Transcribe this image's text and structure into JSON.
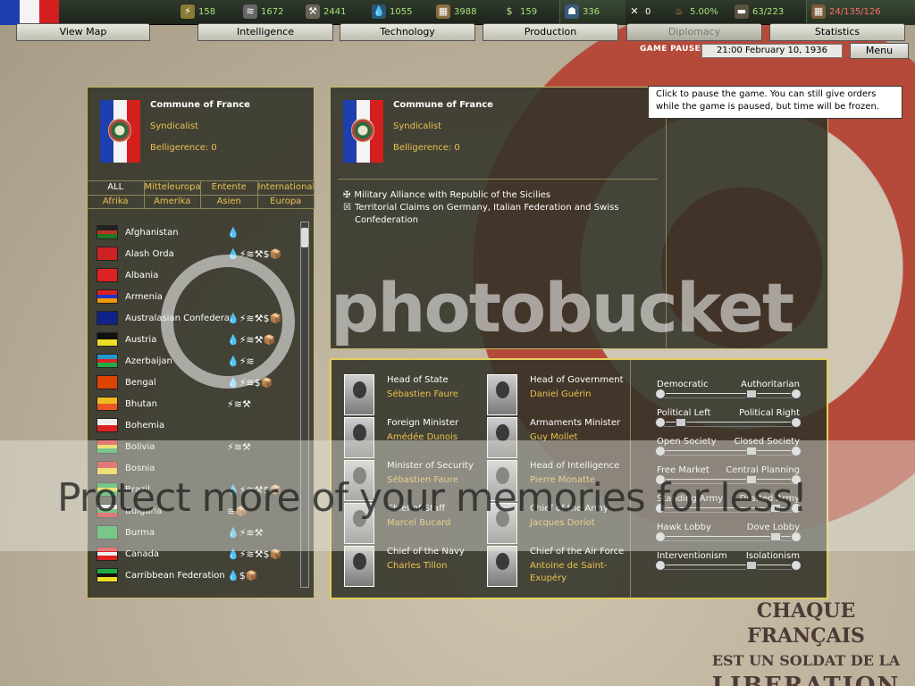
{
  "colors": {
    "accent_gold": "#e9c24f",
    "france_blue": "#1f3fae",
    "france_white": "#f4f4f4",
    "france_red": "#d41f1f"
  },
  "resources": [
    {
      "icon": "energy-icon",
      "value": "158"
    },
    {
      "icon": "metal-icon",
      "value": "1672"
    },
    {
      "icon": "rare-materials-icon",
      "value": "2441"
    },
    {
      "icon": "oil-icon",
      "value": "1055"
    },
    {
      "icon": "supplies-icon",
      "value": "3988"
    },
    {
      "icon": "money-icon",
      "value": "159"
    }
  ],
  "stats": {
    "manpower": "336",
    "diplo_points": "0",
    "dissent": "5.00%",
    "transports": "63/223",
    "convoys": "24/135/126"
  },
  "tabs": [
    "View Map",
    "Intelligence",
    "Technology",
    "Production",
    "Diplomacy",
    "Statistics"
  ],
  "status": {
    "paused": "GAME PAUSED",
    "date": "21:00 February 10, 1936",
    "menu": "Menu",
    "tooltip": "Click to pause the game. You can still give orders while the game is paused, but time will be frozen."
  },
  "country": {
    "name": "Commune of France",
    "ideology": "Syndicalist",
    "belligerence": "Belligerence: 0"
  },
  "filters": {
    "row1": [
      "ALL",
      "Mitteleuropa",
      "Entente",
      "Internationale"
    ],
    "row2": [
      "Afrika",
      "Amerika",
      "Asien",
      "Europa"
    ]
  },
  "countries": [
    {
      "name": "Afghanistan",
      "icons": "💧"
    },
    {
      "name": "Alash Orda",
      "icons": "💧⚡≋⚒$📦"
    },
    {
      "name": "Albania",
      "icons": ""
    },
    {
      "name": "Armenia",
      "icons": ""
    },
    {
      "name": "Australasian Confederation",
      "icons": "💧⚡≋⚒$📦"
    },
    {
      "name": "Austria",
      "icons": "💧⚡≋⚒📦"
    },
    {
      "name": "Azerbaijan",
      "icons": "💧⚡≋"
    },
    {
      "name": "Bengal",
      "icons": "💧⚡≋$📦"
    },
    {
      "name": "Bhutan",
      "icons": "⚡≋⚒"
    },
    {
      "name": "Bohemia",
      "icons": ""
    },
    {
      "name": "Bolivia",
      "icons": "⚡≋⚒"
    },
    {
      "name": "Bosnia",
      "icons": ""
    },
    {
      "name": "Brazil",
      "icons": "💧⚡≋⚒$📦"
    },
    {
      "name": "Bulgaria",
      "icons": "≋📦"
    },
    {
      "name": "Burma",
      "icons": "💧⚡≋⚒"
    },
    {
      "name": "Canada",
      "icons": "💧⚡≋⚒$📦"
    },
    {
      "name": "Carribbean Federation",
      "icons": "💧$📦"
    }
  ],
  "relations": [
    "Military Alliance with Republic of the Sicilies",
    "Territorial Claims on Germany, Italian Federation and Swiss Confederation"
  ],
  "ministers": [
    {
      "title": "Head of State",
      "name": "Sébastien Faure"
    },
    {
      "title": "Head of Government",
      "name": "Daniel Guérin"
    },
    {
      "title": "Foreign Minister",
      "name": "Amédée Dunois"
    },
    {
      "title": "Armaments Minister",
      "name": "Guy Mollet"
    },
    {
      "title": "Minister of Security",
      "name": "Sébastien Faure"
    },
    {
      "title": "Head of Intelligence",
      "name": "Pierre Monatte"
    },
    {
      "title": "Chief of Staff",
      "name": "Marcel Bucard"
    },
    {
      "title": "Chief of the Army",
      "name": "Jacques Doriot"
    },
    {
      "title": "Chief of the Navy",
      "name": "Charles Tillon"
    },
    {
      "title": "Chief of the Air Force",
      "name": "Antoine de Saint-Exupéry"
    }
  ],
  "sliders": [
    {
      "left": "Democratic",
      "right": "Authoritarian",
      "value": 0.7
    },
    {
      "left": "Political Left",
      "right": "Political Right",
      "value": 0.1
    },
    {
      "left": "Open Society",
      "right": "Closed Society",
      "value": 0.7
    },
    {
      "left": "Free Market",
      "right": "Central Planning",
      "value": 0.7
    },
    {
      "left": "Standing Army",
      "right": "Drafted Army",
      "value": 0.9
    },
    {
      "left": "Hawk Lobby",
      "right": "Dove Lobby",
      "value": 0.9
    },
    {
      "left": "Interventionism",
      "right": "Isolationism",
      "value": 0.7
    }
  ],
  "watermark": {
    "brand": "photobucket",
    "slogan": "Protect more of your memories for less!"
  },
  "poster": [
    "CHAQUE FRANÇAIS",
    "EST UN SOLDAT DE LA",
    "LIBERATION"
  ]
}
